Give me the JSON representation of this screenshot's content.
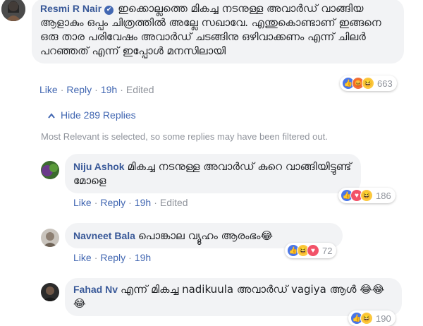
{
  "top_comment": {
    "author": "Resmi R Nair",
    "text": "ഇക്കൊല്ലത്തെ മികച്ച നടനുള്ള അവാർഡ് വാങ്ങിയ ആളാകും ഒപ്പം ചിത്രത്തിൽ അല്ലേ സഖാവേ. എന്തുകൊണ്ടാണ് ഇങ്ങനെ ഒരു താര പരിവേഷം അവാർഡ് ചടങ്ങിനു ഒഴിവാക്കണം എന്ന് ചിലർ പറഞ്ഞത് എന്ന് ഇപ്പോൾ മനസിലായി",
    "like": "Like",
    "reply": "Reply",
    "time": "19h",
    "edited": "Edited",
    "reaction_count": "663",
    "reactions": [
      "like-icon",
      "angry-icon",
      "haha-icon"
    ]
  },
  "hide_replies": "Hide 289 Replies",
  "relevance_note": "Most Relevant is selected, so some replies may have been filtered out.",
  "replies": [
    {
      "author": "Niju Ashok",
      "text": "മികച്ച നടനുള്ള അവാർഡ് കുറെ വാങ്ങിയിട്ടുണ്ട് മോളെ",
      "like": "Like",
      "reply": "Reply",
      "time": "19h",
      "edited": "Edited",
      "reaction_count": "186",
      "reactions": [
        "like-icon",
        "love-icon",
        "haha-icon"
      ]
    },
    {
      "author": "Navneet Bala",
      "text": "പൊങ്കാല വ്യൂഹം ആരംഭം😂",
      "like": "Like",
      "reply": "Reply",
      "time": "19h",
      "reaction_count": "72",
      "reactions": [
        "like-icon",
        "haha-icon",
        "love-icon"
      ]
    },
    {
      "author": "Fahad Nv",
      "text": "എന്ന് മികച്ച nadikuula അവാർഡ് vagiya ആൾ 😂😂😂",
      "reaction_count": "190",
      "reactions": [
        "like-icon",
        "haha-icon"
      ]
    }
  ]
}
